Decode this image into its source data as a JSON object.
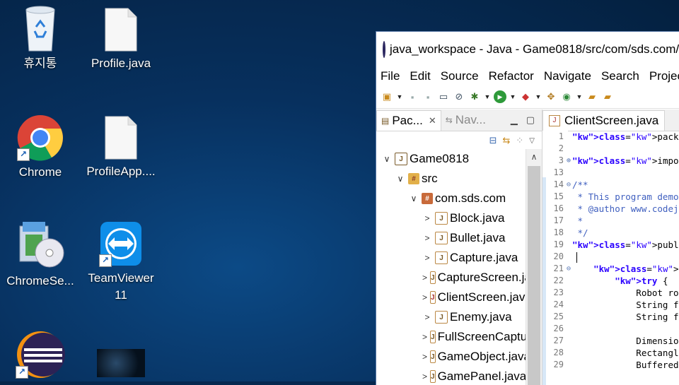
{
  "desktop": {
    "icons": [
      {
        "label": "휴지통",
        "icon": "recycle-bin-icon"
      },
      {
        "label": "Profile.java",
        "icon": "file-icon"
      },
      {
        "label": "Chrome",
        "icon": "chrome-icon"
      },
      {
        "label": "ProfileApp....",
        "icon": "file-icon"
      },
      {
        "label": "ChromeSe...",
        "icon": "installer-icon"
      },
      {
        "label": "TeamViewer 11",
        "icon": "teamviewer-icon"
      },
      {
        "label": "",
        "icon": "eclipse-icon"
      },
      {
        "label": "",
        "icon": "image-thumbnail-icon"
      }
    ]
  },
  "window": {
    "title": "java_workspace - Java - Game0818/src/com/sds.com/ClientScreen.java - Eclipse",
    "menu": [
      "File",
      "Edit",
      "Source",
      "Refactor",
      "Navigate",
      "Search",
      "Project"
    ],
    "left_tabs": [
      {
        "label": "Pac...",
        "active": true
      },
      {
        "label": "Nav...",
        "active": false
      }
    ],
    "tree": [
      {
        "depth": 0,
        "chev": "∨",
        "label": "Game0818",
        "kind": "project"
      },
      {
        "depth": 1,
        "chev": "∨",
        "label": "src",
        "kind": "src"
      },
      {
        "depth": 2,
        "chev": "∨",
        "label": "com.sds.com",
        "kind": "package"
      },
      {
        "depth": 3,
        "chev": ">",
        "label": "Block.java",
        "kind": "java"
      },
      {
        "depth": 3,
        "chev": ">",
        "label": "Bullet.java",
        "kind": "java"
      },
      {
        "depth": 3,
        "chev": ">",
        "label": "Capture.java",
        "kind": "java"
      },
      {
        "depth": 3,
        "chev": ">",
        "label": "CaptureScreen.java",
        "kind": "java"
      },
      {
        "depth": 3,
        "chev": ">",
        "label": "ClientScreen.java",
        "kind": "java-error"
      },
      {
        "depth": 3,
        "chev": ">",
        "label": "Enemy.java",
        "kind": "java"
      },
      {
        "depth": 3,
        "chev": ">",
        "label": "FullScreenCapture.java",
        "kind": "java"
      },
      {
        "depth": 3,
        "chev": ">",
        "label": "GameObject.java",
        "kind": "java-abstract"
      },
      {
        "depth": 3,
        "chev": ">",
        "label": "GamePanel.java",
        "kind": "java"
      }
    ],
    "editor_tab": "ClientScreen.java",
    "code": [
      {
        "n": "1",
        "fold": "",
        "text": "package com.sds.com;",
        "style": "pkg"
      },
      {
        "n": "2",
        "fold": "",
        "text": "",
        "style": "plain"
      },
      {
        "n": "3",
        "fold": "⊕",
        "text": "import java.awt.AWTException;",
        "style": "import"
      },
      {
        "n": "13",
        "fold": "",
        "text": "",
        "style": "plain"
      },
      {
        "n": "14",
        "fold": "⊖",
        "text": "/**",
        "style": "comment"
      },
      {
        "n": "15",
        "fold": "",
        "text": " * This program demonstrates how to capture",
        "style": "comment"
      },
      {
        "n": "16",
        "fold": "",
        "text": " * @author www.codejava.net",
        "style": "comment"
      },
      {
        "n": "17",
        "fold": "",
        "text": " *",
        "style": "comment"
      },
      {
        "n": "18",
        "fold": "",
        "text": " */",
        "style": "comment"
      },
      {
        "n": "19",
        "fold": "",
        "text": "public class PartialScreenCapture {",
        "style": "class"
      },
      {
        "n": "20",
        "fold": "",
        "text": "",
        "style": "caret"
      },
      {
        "n": "21",
        "fold": "⊖",
        "text": "    public static void main(String[] args) {",
        "style": "method"
      },
      {
        "n": "22",
        "fold": "",
        "text": "        try {",
        "style": "try"
      },
      {
        "n": "23",
        "fold": "",
        "text": "            Robot robot = new Robot();",
        "style": "plain"
      },
      {
        "n": "24",
        "fold": "",
        "text": "            String format = \"jpg\";",
        "style": "plain"
      },
      {
        "n": "25",
        "fold": "",
        "text": "            String fileName = \"Partial\";",
        "style": "plain"
      },
      {
        "n": "26",
        "fold": "",
        "text": "",
        "style": "plain"
      },
      {
        "n": "27",
        "fold": "",
        "text": "            Dimension screenSize;",
        "style": "plain"
      },
      {
        "n": "28",
        "fold": "",
        "text": "            Rectangle captureRect;",
        "style": "plain"
      },
      {
        "n": "29",
        "fold": "",
        "text": "            BufferedImage screenFullImage;",
        "style": "plain"
      }
    ]
  }
}
